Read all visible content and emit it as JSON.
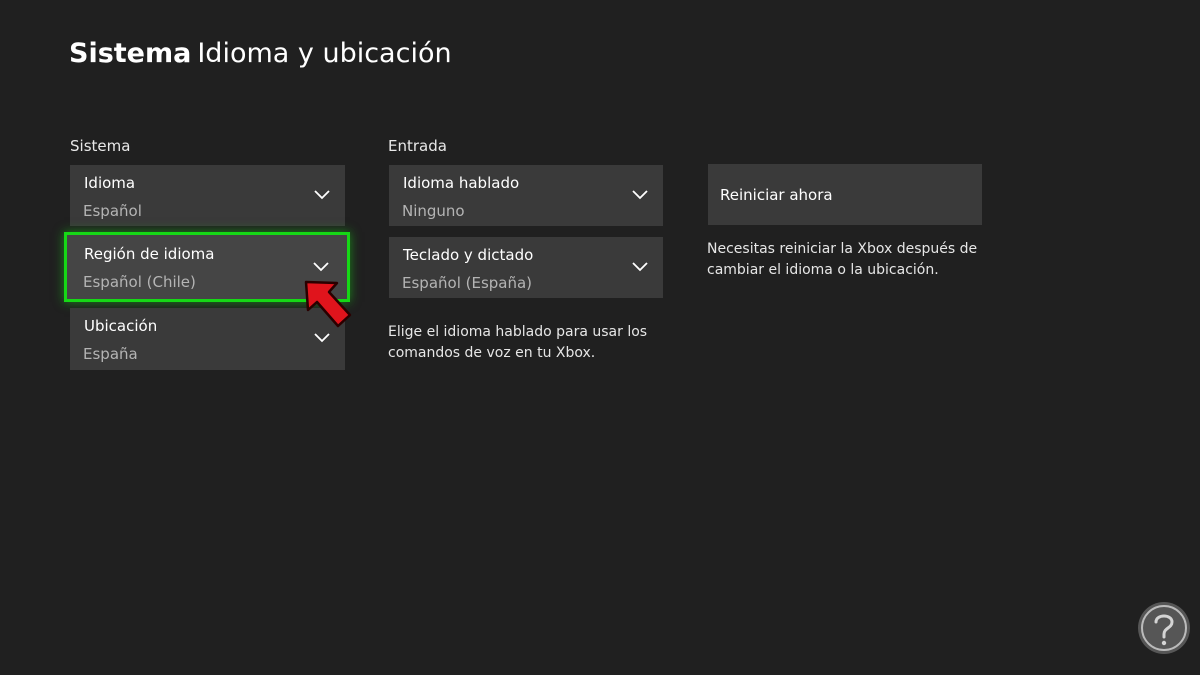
{
  "header": {
    "title_strong": "Sistema",
    "title_rest": "Idioma y ubicación"
  },
  "sistema": {
    "header": "Sistema",
    "items": [
      {
        "label": "Idioma",
        "value": "Español"
      },
      {
        "label": "Región de idioma",
        "value": "Español (Chile)"
      },
      {
        "label": "Ubicación",
        "value": "España"
      }
    ]
  },
  "entrada": {
    "header": "Entrada",
    "items": [
      {
        "label": "Idioma hablado",
        "value": "Ninguno"
      },
      {
        "label": "Teclado y dictado",
        "value": "Español (España)"
      }
    ],
    "description_line1": "Elige el idioma hablado para usar los",
    "description_line2": "comandos de voz en tu Xbox."
  },
  "reiniciar": {
    "button_label": "Reiniciar ahora",
    "description_line1": "Necesitas reiniciar la Xbox después de",
    "description_line2": "cambiar el idioma o la ubicación."
  },
  "colors": {
    "background": "#202020",
    "tile": "#3a3a3a",
    "focus_outline": "#16d816",
    "annotation_arrow": "#e0141c"
  },
  "icons": {
    "dropdown": "chevron-down-icon",
    "annotation": "arrow-pointer-icon",
    "watermark": "logo-icon"
  }
}
